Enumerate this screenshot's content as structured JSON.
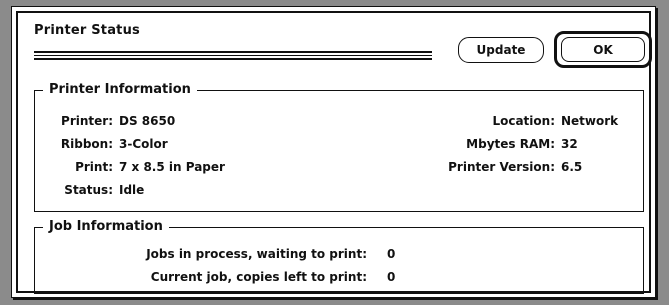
{
  "window": {
    "title": "Printer Status"
  },
  "buttons": {
    "update_label": "Update",
    "ok_label": "OK"
  },
  "printer_info": {
    "legend": "Printer Information",
    "left": [
      {
        "label": "Printer:",
        "value": "DS 8650"
      },
      {
        "label": "Ribbon:",
        "value": "3-Color"
      },
      {
        "label": "Print:",
        "value": "7 x 8.5 in Paper"
      },
      {
        "label": "Status:",
        "value": "Idle"
      }
    ],
    "right": [
      {
        "label": "Location:",
        "value": "Network"
      },
      {
        "label": "Mbytes RAM:",
        "value": "32"
      },
      {
        "label": "Printer Version:",
        "value": "6.5"
      }
    ]
  },
  "job_info": {
    "legend": "Job Information",
    "rows": [
      {
        "label": "Jobs in process, waiting to print:",
        "value": "0"
      },
      {
        "label": "Current job, copies left to print:",
        "value": "0"
      }
    ]
  }
}
